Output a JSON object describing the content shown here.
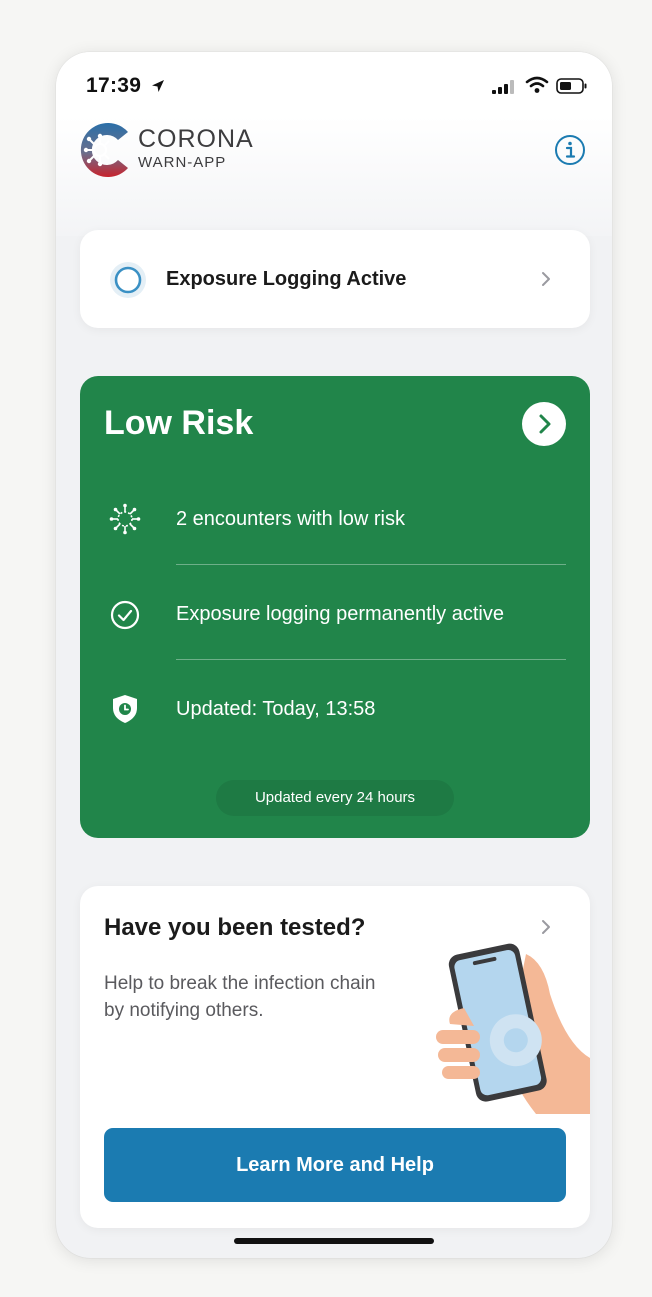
{
  "status_bar": {
    "time": "17:39",
    "icons": [
      "location-arrow-icon",
      "cellular-signal-icon",
      "wifi-icon",
      "battery-icon"
    ]
  },
  "header": {
    "logo_title": "CORONA",
    "logo_subtitle": "WARN-APP",
    "logo_icon": "corona-virus-logo-icon",
    "info_icon": "info-icon"
  },
  "exposure_card": {
    "title": "Exposure Logging Active",
    "icon": "pulse-ring-icon"
  },
  "risk_card": {
    "title": "Low Risk",
    "color": "#21854a",
    "rows": [
      {
        "icon": "virus-encounters-icon",
        "text": "2 encounters with low risk"
      },
      {
        "icon": "check-circle-icon",
        "text": "Exposure logging permanently active"
      },
      {
        "icon": "shield-clock-icon",
        "text": "Updated: Today, 13:58"
      }
    ],
    "update_pill": "Updated every 24 hours"
  },
  "tested_card": {
    "title": "Have you been tested?",
    "text": "Help to break the infection chain by notifying others.",
    "illustration": "hand-holding-phone-illustration",
    "button_label": "Learn More and Help",
    "button_color": "#1b7bb1"
  }
}
